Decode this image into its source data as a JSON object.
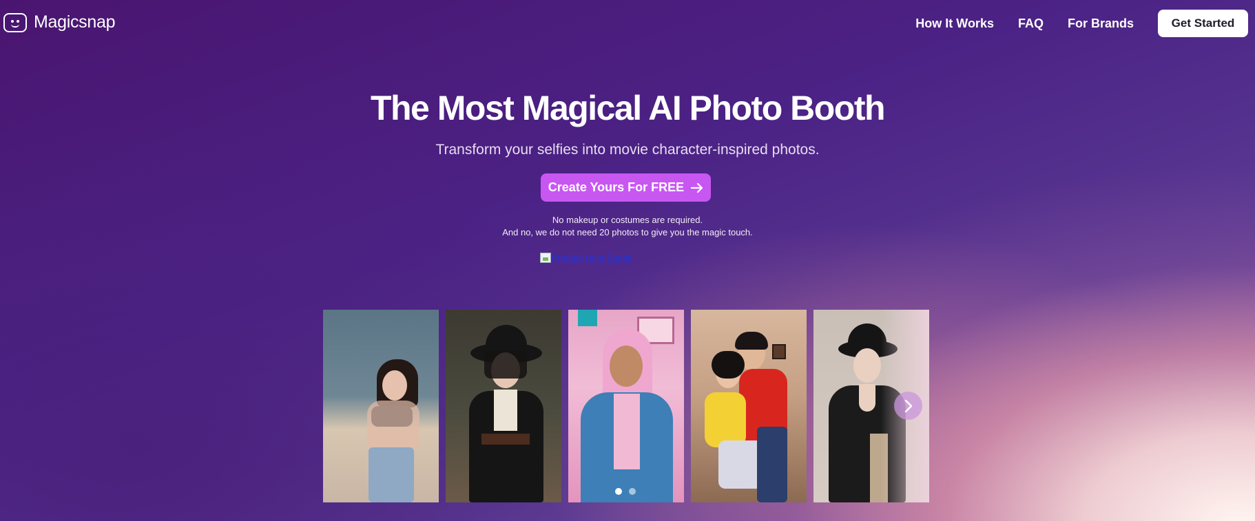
{
  "header": {
    "brand": "Magicsnap",
    "nav": [
      "How It Works",
      "FAQ",
      "For Brands"
    ],
    "cta_label": "Get Started"
  },
  "hero": {
    "title": "The Most Magical AI Photo Booth",
    "subtitle": "Transform your selfies into movie character-inspired photos.",
    "cta_label": "Create Yours For FREE",
    "note_line1": "No makeup or costumes are required.",
    "note_line2": "And no, we do not need 20 photos to give you the magic touch.",
    "badge_alt": "Product Hunt Badge"
  },
  "carousel": {
    "active_slide": 1,
    "slide_count": 2
  }
}
